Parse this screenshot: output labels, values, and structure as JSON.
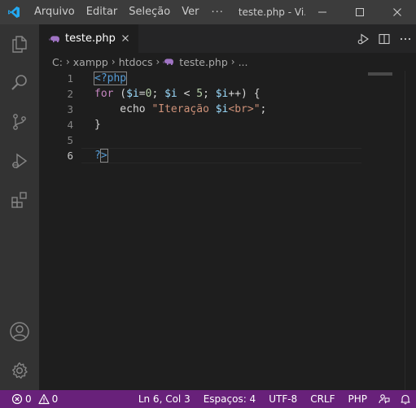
{
  "titlebar": {
    "menu": [
      "Arquivo",
      "Editar",
      "Seleção",
      "Ver"
    ],
    "more": "···",
    "window_title": "teste.php - Vi..."
  },
  "tab": {
    "label": "teste.php",
    "icon": "php-elephant-icon"
  },
  "breadcrumb": [
    "C:",
    "xampp",
    "htdocs",
    "teste.php",
    "..."
  ],
  "editor": {
    "line_numbers": [
      "1",
      "2",
      "3",
      "4",
      "5",
      "6"
    ],
    "active_line": "6",
    "code": {
      "l1_open": "<?php",
      "l2_for": "for",
      "l2_a": " (",
      "l2_i1": "$i",
      "l2_b": "=",
      "l2_zero": "0",
      "l2_c": "; ",
      "l2_i2": "$i",
      "l2_d": " < ",
      "l2_five": "5",
      "l2_e": "; ",
      "l2_i3": "$i",
      "l2_f": "++) {",
      "l3_echo": "    echo",
      "l3_sp": " ",
      "l3_str1": "\"Iteração ",
      "l3_var": "$i",
      "l3_str2": "<br>\"",
      "l3_end": ";",
      "l4_close": "}",
      "l6_q": "?",
      "l6_gt": ">"
    }
  },
  "statusbar": {
    "errors": "0",
    "warnings": "0",
    "position": "Ln 6, Col 3",
    "spaces": "Espaços: 4",
    "encoding": "UTF-8",
    "eol": "CRLF",
    "language": "PHP"
  },
  "colors": {
    "statusbar": "#68217a",
    "titlebar": "#3c3c3c",
    "activitybar": "#333333",
    "editor": "#1e1e1e"
  }
}
